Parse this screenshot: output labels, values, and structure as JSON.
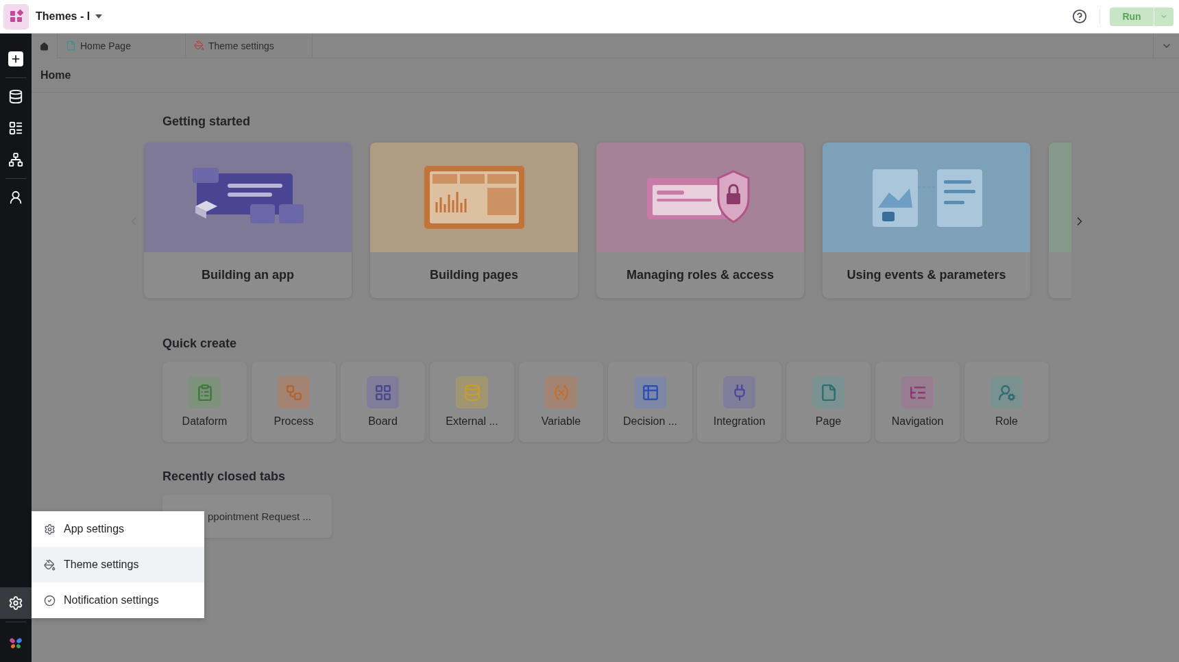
{
  "app": {
    "title": "Themes - I"
  },
  "toolbar": {
    "run_label": "Run"
  },
  "sidebar": {
    "top_items": [
      {
        "kind": "create",
        "selected": false
      },
      {
        "kind": "data",
        "selected": false
      },
      {
        "kind": "forms",
        "selected": false
      },
      {
        "kind": "flow",
        "selected": false
      },
      {
        "kind": "users",
        "selected": false
      }
    ],
    "bottom_items": [
      {
        "kind": "settings",
        "selected": true
      }
    ]
  },
  "tabs": [
    {
      "kind": "home",
      "selected": true
    },
    {
      "kind": "page",
      "label": "Home Page",
      "selected": false
    },
    {
      "kind": "theme",
      "label": "Theme settings",
      "selected": false
    }
  ],
  "header": {
    "title": "Home"
  },
  "getting_started": {
    "title": "Getting started",
    "cards": [
      {
        "kind": "app",
        "title": "Building an app"
      },
      {
        "kind": "pages",
        "title": "Building pages"
      },
      {
        "kind": "roles",
        "title": "Managing roles & access"
      },
      {
        "kind": "events",
        "title": "Using events & parameters"
      },
      {
        "kind": "more"
      }
    ]
  },
  "quick_create": {
    "title": "Quick create",
    "items": [
      {
        "kind": "dataform",
        "label": "Dataform"
      },
      {
        "kind": "process",
        "label": "Process"
      },
      {
        "kind": "board",
        "label": "Board"
      },
      {
        "kind": "external",
        "label": "External ..."
      },
      {
        "kind": "variable",
        "label": "Variable"
      },
      {
        "kind": "decision",
        "label": "Decision ..."
      },
      {
        "kind": "integration",
        "label": "Integration"
      },
      {
        "kind": "page",
        "label": "Page"
      },
      {
        "kind": "navigation",
        "label": "Navigation"
      },
      {
        "kind": "role",
        "label": "Role"
      }
    ]
  },
  "recently_closed": {
    "title": "Recently closed tabs",
    "items": [
      {
        "label": "ppointment Request ..."
      }
    ]
  },
  "settings_menu": {
    "items": [
      {
        "kind": "app",
        "label": "App settings",
        "selected": false
      },
      {
        "kind": "theme",
        "label": "Theme settings",
        "selected": true
      },
      {
        "kind": "notification",
        "label": "Notification settings",
        "selected": false
      }
    ]
  }
}
